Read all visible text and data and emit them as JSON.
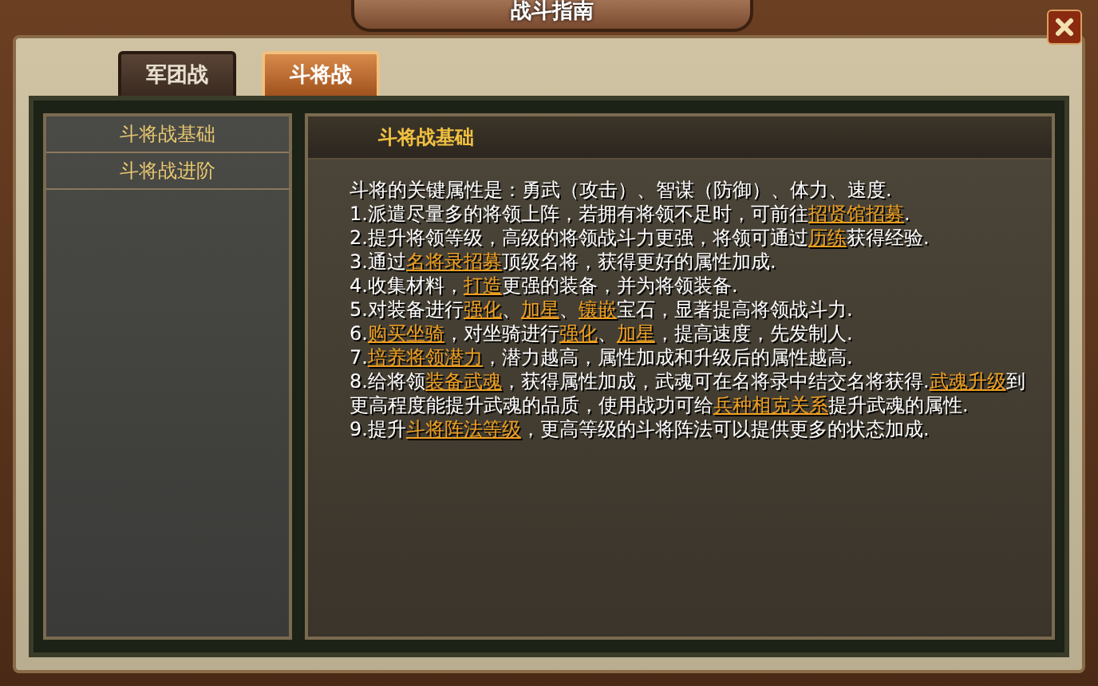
{
  "window": {
    "title": "战斗指南"
  },
  "tabs": [
    {
      "label": "军团战",
      "selected": false
    },
    {
      "label": "斗将战",
      "selected": true
    }
  ],
  "sidebar": {
    "items": [
      "斗将战基础",
      "斗将战进阶"
    ]
  },
  "content": {
    "heading": "斗将战基础",
    "paragraphs": [
      [
        {
          "kind": "text",
          "text": "斗将的关键属性是：勇武（攻击）、智谋（防御）、体力、速度."
        }
      ],
      [
        {
          "kind": "text",
          "text": "1.派遣尽量多的将领上阵，若拥有将领不足时，可前往"
        },
        {
          "kind": "link",
          "text": "招贤馆招募"
        },
        {
          "kind": "text",
          "text": "."
        }
      ],
      [
        {
          "kind": "text",
          "text": "2.提升将领等级，高级的将领战斗力更强，将领可通过"
        },
        {
          "kind": "link",
          "text": "历练"
        },
        {
          "kind": "text",
          "text": "获得经验."
        }
      ],
      [
        {
          "kind": "text",
          "text": "3.通过"
        },
        {
          "kind": "link",
          "text": "名将录招募"
        },
        {
          "kind": "text",
          "text": "顶级名将，获得更好的属性加成."
        }
      ],
      [
        {
          "kind": "text",
          "text": "4.收集材料，"
        },
        {
          "kind": "link",
          "text": "打造"
        },
        {
          "kind": "text",
          "text": "更强的装备，并为将领装备."
        }
      ],
      [
        {
          "kind": "text",
          "text": "5.对装备进行"
        },
        {
          "kind": "link",
          "text": "强化"
        },
        {
          "kind": "text",
          "text": "、"
        },
        {
          "kind": "link",
          "text": "加星"
        },
        {
          "kind": "text",
          "text": "、"
        },
        {
          "kind": "link",
          "text": "镶嵌"
        },
        {
          "kind": "text",
          "text": "宝石，显著提高将领战斗力."
        }
      ],
      [
        {
          "kind": "text",
          "text": "6."
        },
        {
          "kind": "link",
          "text": "购买坐骑"
        },
        {
          "kind": "text",
          "text": "，对坐骑进行"
        },
        {
          "kind": "link",
          "text": "强化"
        },
        {
          "kind": "text",
          "text": "、"
        },
        {
          "kind": "link",
          "text": "加星"
        },
        {
          "kind": "text",
          "text": "，提高速度，先发制人."
        }
      ],
      [
        {
          "kind": "text",
          "text": "7."
        },
        {
          "kind": "link",
          "text": "培养将领潜力"
        },
        {
          "kind": "text",
          "text": "，潜力越高，属性加成和升级后的属性越高."
        }
      ],
      [
        {
          "kind": "text",
          "text": "8.给将领"
        },
        {
          "kind": "link",
          "text": "装备武魂"
        },
        {
          "kind": "text",
          "text": "，获得属性加成，武魂可在名将录中结交名将获得."
        },
        {
          "kind": "link",
          "text": "武魂升级"
        },
        {
          "kind": "text",
          "text": "到更高程度能提升武魂的品质，使用战功可给"
        },
        {
          "kind": "link",
          "text": "兵种相克关系"
        },
        {
          "kind": "text",
          "text": "提升武魂的属性."
        }
      ],
      [
        {
          "kind": "text",
          "text": "9.提升"
        },
        {
          "kind": "link",
          "text": "斗将阵法等级"
        },
        {
          "kind": "text",
          "text": "，更高等级的斗将阵法可以提供更多的状态加成."
        }
      ]
    ]
  }
}
